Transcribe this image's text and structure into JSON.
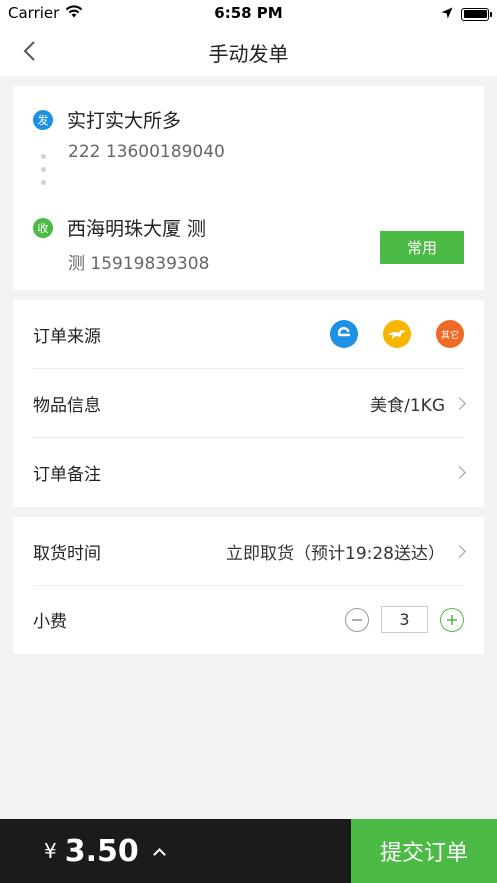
{
  "status_bar": {
    "carrier": "Carrier",
    "time": "6:58 PM"
  },
  "nav": {
    "title": "手动发单"
  },
  "address": {
    "sender": {
      "tag": "发",
      "name": "实打实大所多",
      "contact": "222 13600189040"
    },
    "receiver": {
      "tag": "收",
      "name": "西海明珠大厦 测",
      "contact": "测 15919839308"
    },
    "common_label": "常用"
  },
  "order_info": {
    "source_label": "订单来源",
    "source_icons": [
      {
        "name": "ele",
        "text": "e"
      },
      {
        "name": "meituan",
        "text": ""
      },
      {
        "name": "other",
        "text": "其它"
      }
    ],
    "goods_label": "物品信息",
    "goods_value": "美食/1KG",
    "remark_label": "订单备注"
  },
  "pickup": {
    "time_label": "取货时间",
    "time_value": "立即取货（预计19:28送达）",
    "tip_label": "小费",
    "tip_value": "3"
  },
  "footer": {
    "currency": "¥",
    "amount": "3.50",
    "submit_label": "提交订单"
  },
  "colors": {
    "green": "#4cbb45",
    "blue": "#1e90e6",
    "orange": "#f06a25",
    "yellow": "#f7b500",
    "dark": "#1b1b1b"
  }
}
